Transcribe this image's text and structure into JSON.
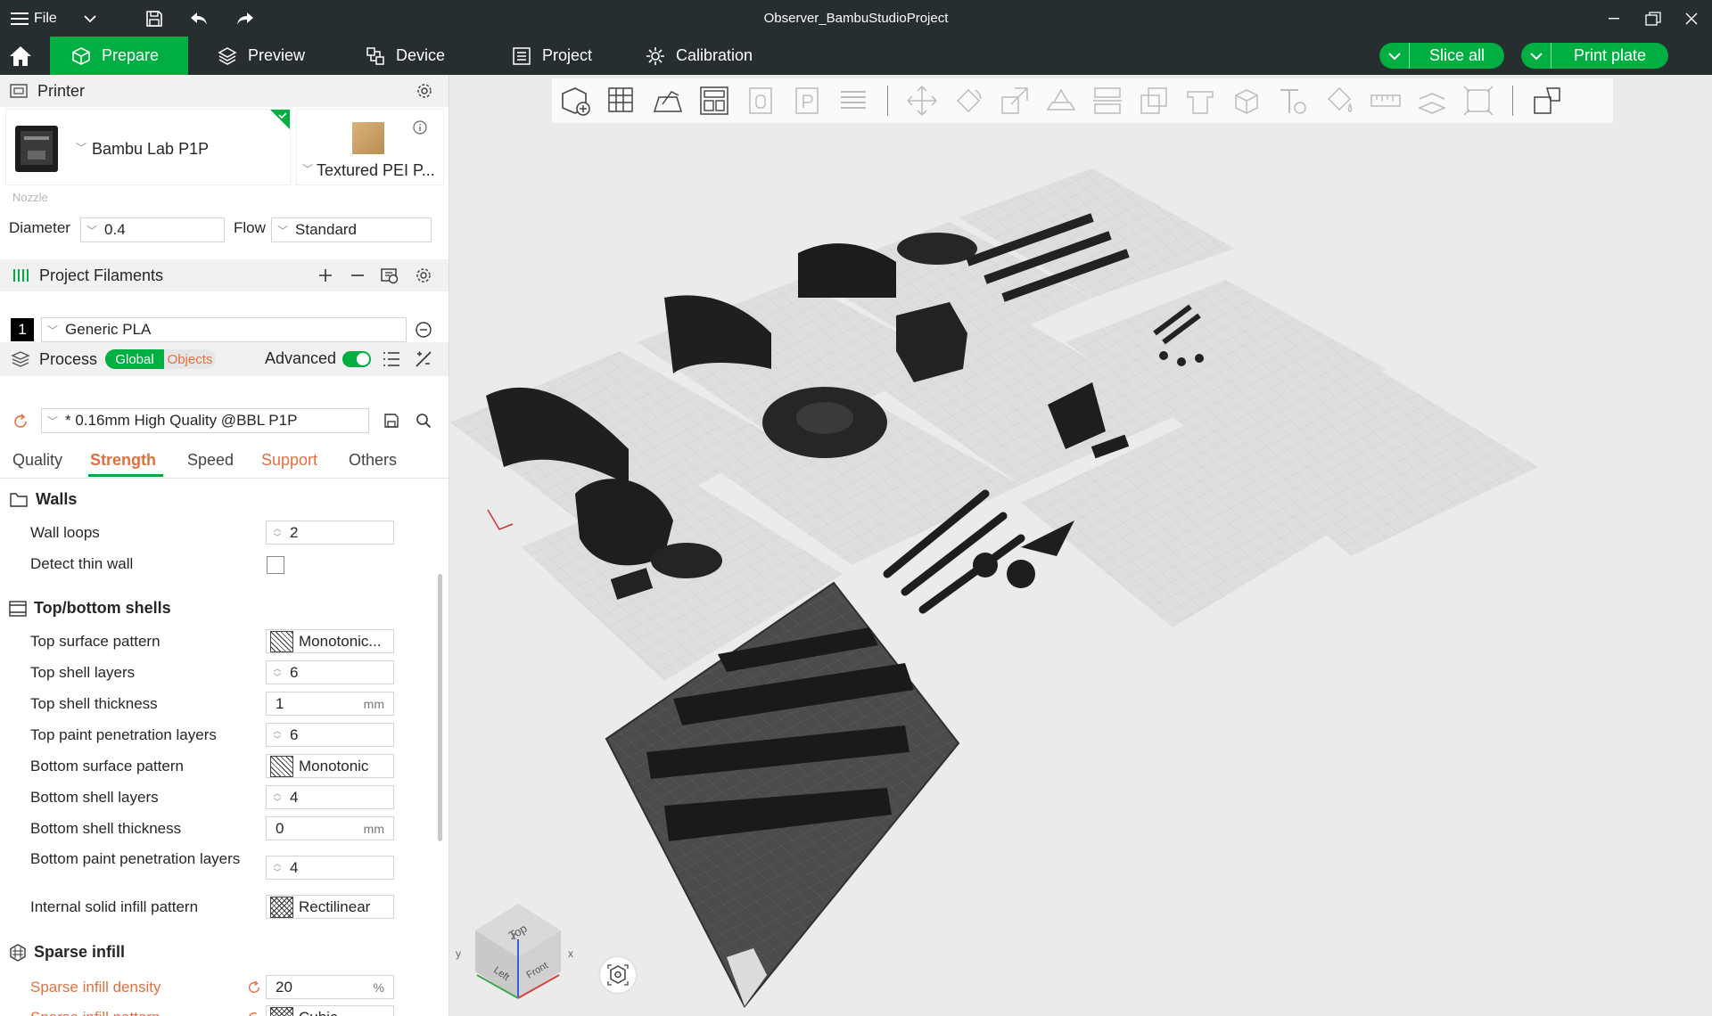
{
  "titlebar": {
    "menu_label": "File",
    "window_title": "Observer_BambuStudioProject"
  },
  "tabs": [
    {
      "label": "Prepare",
      "icon": "cube-icon",
      "active": true
    },
    {
      "label": "Preview",
      "icon": "layers-icon"
    },
    {
      "label": "Device",
      "icon": "device-icon"
    },
    {
      "label": "Project",
      "icon": "project-icon"
    },
    {
      "label": "Calibration",
      "icon": "calibration-icon"
    }
  ],
  "actions": {
    "slice_label": "Slice all",
    "print_label": "Print plate"
  },
  "printer": {
    "section_title": "Printer",
    "model": "Bambu Lab P1P",
    "plate": "Textured PEI P...",
    "nozzle_label": "Nozzle",
    "diameter_label": "Diameter",
    "diameter_value": "0.4",
    "flow_label": "Flow",
    "flow_value": "Standard"
  },
  "filaments": {
    "section_title": "Project Filaments",
    "items": [
      {
        "index": "1",
        "name": "Generic PLA",
        "color": "#000000"
      }
    ]
  },
  "process": {
    "section_title": "Process",
    "global_label": "Global",
    "objects_label": "Objects",
    "advanced_label": "Advanced",
    "preset": "* 0.16mm High Quality @BBL P1P",
    "subtabs": [
      "Quality",
      "Strength",
      "Speed",
      "Support",
      "Others"
    ]
  },
  "strength": {
    "walls": {
      "title": "Walls",
      "wall_loops_label": "Wall loops",
      "wall_loops": "2",
      "detect_thin_wall_label": "Detect thin wall"
    },
    "shells": {
      "title": "Top/bottom shells",
      "top_surface_pattern_label": "Top surface pattern",
      "top_surface_pattern": "Monotonic...",
      "top_shell_layers_label": "Top shell layers",
      "top_shell_layers": "6",
      "top_shell_thickness_label": "Top shell thickness",
      "top_shell_thickness": "1",
      "top_paint_label": "Top paint penetration layers",
      "top_paint": "6",
      "bottom_surface_pattern_label": "Bottom surface pattern",
      "bottom_surface_pattern": "Monotonic",
      "bottom_shell_layers_label": "Bottom shell layers",
      "bottom_shell_layers": "4",
      "bottom_shell_thickness_label": "Bottom shell thickness",
      "bottom_shell_thickness": "0",
      "bottom_paint_label": "Bottom paint penetration layers",
      "bottom_paint": "4",
      "internal_pattern_label": "Internal solid infill pattern",
      "internal_pattern": "Rectilinear",
      "unit_mm": "mm"
    },
    "infill": {
      "title": "Sparse infill",
      "density_label": "Sparse infill density",
      "density": "20",
      "density_unit": "%",
      "pattern_label": "Sparse infill pattern",
      "pattern": "Cubic"
    }
  },
  "navcube": {
    "top": "Top",
    "left": "Left",
    "front": "Front",
    "axis_x": "x",
    "axis_y": "y",
    "axis_z": "z"
  },
  "colors": {
    "accent": "#00ae42",
    "titlebar": "#262e30",
    "orange": "#e26f3f"
  }
}
